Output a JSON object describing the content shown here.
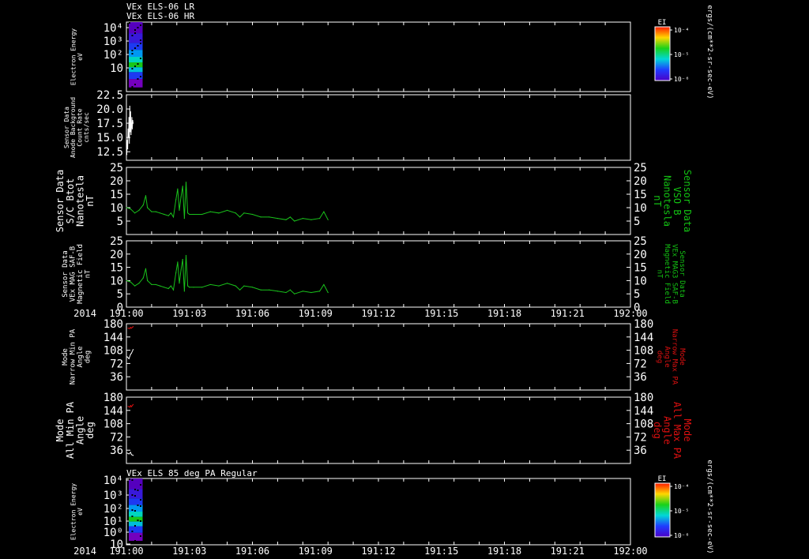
{
  "colors": {
    "background": "#000000",
    "axis": "#ffffff",
    "mag": "#19c21b",
    "mag_label": "#13c213",
    "pa_max": "#e01010",
    "pa_min": "#ffffff"
  },
  "xaxis": {
    "year_label": "2014",
    "tick_labels": [
      "191:00",
      "191:03",
      "191:06",
      "191:09",
      "191:12",
      "191:15",
      "191:18",
      "191:21",
      "192:00"
    ]
  },
  "titles": {
    "panel1_line1": "VEx ELS-06 LR",
    "panel1_line2": "VEx ELS-06 HR",
    "panel7": "VEx ELS 85 deg PA Regular"
  },
  "colorbars": [
    {
      "title": "EI",
      "tick_labels": [
        "10⁻⁴",
        "10⁻⁵",
        "10⁻⁶"
      ],
      "unit": "ergs/(cm**2-sr-sec-eV)"
    },
    {
      "title": "EI",
      "tick_labels": [
        "10⁻⁴",
        "10⁻⁵",
        "10⁻⁶"
      ],
      "unit": "ergs/(cm**2-sr-sec-eV)"
    }
  ],
  "chart_data": [
    {
      "type": "heatmap",
      "ylabel_lines": [
        "Electron Energy",
        "eV"
      ],
      "y_scale": "log",
      "y_tick_labels": [
        "10⁴",
        "10³",
        "10²",
        "10"
      ],
      "x_range": [
        "191:00",
        "192:00"
      ],
      "data_extent_minutes": [
        0.0,
        0.8
      ],
      "colorbar": "EI"
    },
    {
      "type": "line",
      "ylabel_lines": [
        "Sensor Data",
        "Anode Background",
        "Count Rate",
        "cnts/sec"
      ],
      "ylim": [
        11,
        22.5
      ],
      "y_tick_labels": [
        "22.5",
        "20.0",
        "17.5",
        "15.0",
        "12.5"
      ],
      "series": [
        {
          "x_minutes": [
            0.05,
            0.1,
            0.15,
            0.2,
            0.25,
            0.3,
            0.35,
            0.4,
            0.45,
            0.5,
            0.55,
            0.6,
            0.65,
            0.7,
            0.75,
            0.8
          ],
          "values": [
            12.0,
            14.5,
            13.0,
            16.5,
            15.0,
            18.5,
            14.0,
            20.5,
            16.0,
            19.5,
            15.5,
            17.0,
            18.5,
            16.5,
            18.0,
            17.5
          ]
        }
      ]
    },
    {
      "type": "line",
      "ylabel_lines": [
        "Sensor Data",
        "S/C Btot",
        "Nanotesla",
        "nT"
      ],
      "right_label_lines": [
        "Sensor Data",
        "VSO B",
        "Nanotesla",
        "nT"
      ],
      "ylim": [
        0,
        25
      ],
      "y_tick_labels": [
        "25",
        "20",
        "15",
        "10",
        "5"
      ],
      "series": [
        {
          "x_minutes": [
            0,
            0.5,
            1,
            1.5,
            2,
            2.3,
            2.5,
            3,
            3.5,
            4,
            4.5,
            5,
            5.3,
            5.6,
            5.9,
            6.1,
            6.3,
            6.5,
            6.7,
            6.9,
            7.1,
            7.3,
            7.5,
            8,
            9,
            10,
            11,
            12,
            13,
            13.5,
            14,
            15,
            16,
            17,
            18,
            19,
            19.5,
            20,
            21,
            22,
            23,
            23.5,
            24
          ],
          "values": [
            10,
            9.5,
            8,
            9,
            11,
            14.5,
            10,
            8.5,
            8.5,
            8,
            7.5,
            7,
            8,
            6.5,
            13,
            17,
            9,
            14,
            18,
            6,
            19.5,
            8,
            7.5,
            7.5,
            7.5,
            8.5,
            8,
            9,
            8,
            6.5,
            8,
            7.5,
            6.5,
            6.5,
            6,
            5.5,
            6.5,
            5,
            6,
            5.5,
            6,
            8.5,
            5.5
          ]
        }
      ]
    },
    {
      "type": "line",
      "ylabel_lines": [
        "Sensor Data",
        "VEx MAG SAF-B",
        "Magnetic Field",
        "nT"
      ],
      "right_label_lines": [
        "Sensor Data",
        "VEx MAG3 SAF-B",
        "Magnetic Field",
        "nT"
      ],
      "ylim": [
        0,
        25
      ],
      "y_tick_labels": [
        "25",
        "20",
        "15",
        "10",
        "5",
        "0"
      ],
      "series": [
        {
          "x_minutes": [
            0,
            0.5,
            1,
            1.5,
            2,
            2.3,
            2.5,
            3,
            3.5,
            4,
            4.5,
            5,
            5.3,
            5.6,
            5.9,
            6.1,
            6.3,
            6.5,
            6.7,
            6.9,
            7.1,
            7.3,
            7.5,
            8,
            9,
            10,
            11,
            12,
            13,
            13.5,
            14,
            15,
            16,
            17,
            18,
            19,
            19.5,
            20,
            21,
            22,
            23,
            23.5,
            24
          ],
          "values": [
            10,
            9.5,
            8,
            9,
            11,
            14.5,
            10,
            8.5,
            8.5,
            8,
            7.5,
            7,
            8,
            6.5,
            13,
            17,
            9,
            14,
            18,
            6,
            19.5,
            8,
            7.5,
            7.5,
            7.5,
            8.5,
            8,
            9,
            8,
            6.5,
            8,
            7.5,
            6.5,
            6.5,
            6,
            5.5,
            6.5,
            5,
            6,
            5.5,
            6,
            8.5,
            5.5
          ]
        }
      ]
    },
    {
      "type": "line",
      "ylabel_lines": [
        "Mode",
        "Narrow Min PA",
        "Angle",
        "deg"
      ],
      "right_label_lines": [
        "Mode",
        "Narrow Max PA",
        "Angle",
        "deg"
      ],
      "ylim": [
        0,
        180
      ],
      "y_tick_labels": [
        "180",
        "144",
        "108",
        "72",
        "36"
      ],
      "series": [
        {
          "name": "Narrow Max PA",
          "x_minutes": [
            0.2,
            0.4,
            0.5,
            0.6,
            0.8
          ],
          "values": [
            168,
            167,
            170,
            168,
            172
          ]
        },
        {
          "name": "Narrow Min PA",
          "x_minutes": [
            0.1,
            0.3,
            0.5,
            0.6,
            0.8
          ],
          "values": [
            90,
            85,
            97,
            100,
            110
          ]
        }
      ]
    },
    {
      "type": "line",
      "ylabel_lines": [
        "Mode",
        "All Min PA",
        "Angle",
        "deg"
      ],
      "right_label_lines": [
        "Mode",
        "All Max PA",
        "Angle",
        "deg"
      ],
      "ylim": [
        0,
        180
      ],
      "y_tick_labels": [
        "180",
        "144",
        "108",
        "72",
        "36"
      ],
      "series": [
        {
          "name": "All Max PA",
          "x_minutes": [
            0.2,
            0.4,
            0.5,
            0.6,
            0.8
          ],
          "values": [
            155,
            153,
            157,
            154,
            160
          ]
        },
        {
          "name": "All Min PA",
          "x_minutes": [
            0.1,
            0.3,
            0.5,
            0.6,
            0.8
          ],
          "values": [
            28,
            26,
            30,
            24,
            22
          ]
        }
      ]
    },
    {
      "type": "heatmap",
      "ylabel_lines": [
        "Electron Energy",
        "eV"
      ],
      "y_scale": "log",
      "y_tick_labels": [
        "10⁴",
        "10³",
        "10²",
        "10¹",
        "10⁰",
        "10"
      ],
      "x_range": [
        "191:00",
        "192:00"
      ],
      "data_extent_minutes": [
        0.0,
        0.8
      ],
      "colorbar": "EI"
    }
  ]
}
